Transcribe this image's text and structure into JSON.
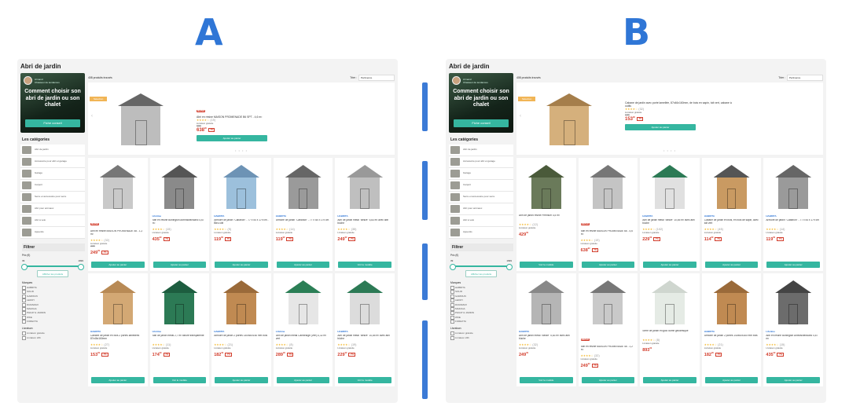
{
  "labels": {
    "a": "A",
    "b": "B"
  },
  "colors": {
    "accent": "#35b6a0",
    "price": "#d23b2a",
    "letter": "#2f76d6"
  },
  "panels": [
    {
      "id": "A",
      "title": "Abri de jardin",
      "result_count": "408 produits trouvés",
      "sort_label": "Trier :",
      "sort_value": "Pertinence",
      "promo": {
        "author": "Armand",
        "role": "Chasseur de tendances",
        "headline": "Comment choisir son abri de jardin ou son chalet",
        "cta": "Fiche conseil"
      },
      "categories_title": "Les catégories",
      "categories": [
        "Abri de jardin",
        "Accessoire pour abri et garage",
        "Garage",
        "Carport",
        "Serre et accessoire pour serre",
        "Abri pour animaux",
        "Abri à vélo",
        "Appentis"
      ],
      "filter_title": "Filtrer",
      "price_label": "Prix (€)",
      "price_min": "39",
      "price_max": "1999",
      "apply_label": "Afficher les produits",
      "brands_title": "Marques",
      "brands": [
        "HABRITA",
        "SOLID",
        "GARDIUN",
        "LEROY",
        "DURAMAX",
        "MAZAGA",
        "PHILIP & JARDIN",
        "WKE",
        "FOREXTA"
      ],
      "delivery_title": "Livraison",
      "delivery": [
        "Livraison gratuite",
        "Livraison 24h"
      ],
      "featured": {
        "tag": "Sélection",
        "badge": "MEPER",
        "title": "Abri en résine MAISON PROMENADE B6 SPT - 4,6 m²",
        "rating": "★★★★☆",
        "reviews": "(19)",
        "shipping": "Livraison gratuite",
        "old_price": "689€",
        "price": "638",
        "cents": "99",
        "discount": "-7%",
        "button": "Ajouter au panier"
      },
      "products": [
        {
          "badge": "MEPER",
          "brand": "",
          "title": "Abri en résine MAISON PROMENADE 48 - 1,2 m²",
          "rating": "★★★★☆",
          "reviews": "(32)",
          "shipping": "Livraison gratuite",
          "price": "249",
          "cents": "99",
          "old": "269€",
          "discount": "-7%",
          "button": "Ajouter au panier",
          "roof": "#777",
          "wall": "#c9c9c9"
        },
        {
          "badge": "",
          "brand": "Lifetime",
          "title": "Abri en résine Burlington Anthracite/Blanc 4,67 m²",
          "rating": "★★★★☆",
          "reviews": "(15)",
          "shipping": "Livraison gratuite",
          "price": "435",
          "cents": "99",
          "old": "",
          "discount": "-7%",
          "button": "Ajouter au panier",
          "roof": "#555",
          "wall": "#8a8a8a"
        },
        {
          "badge": "",
          "brand": "HABRITA",
          "title": "Armoire de jardin \"Cabanon\" - 77 x 54 x 179 cm - Bleu ciel",
          "rating": "★★★★☆",
          "reviews": "(9)",
          "shipping": "Livraison gratuite",
          "price": "119",
          "cents": "99",
          "old": "",
          "discount": "-7%",
          "button": "Ajouter au panier",
          "roof": "#6d93b5",
          "wall": "#9cc0dc"
        },
        {
          "badge": "",
          "brand": "HABRITA",
          "title": "Armoire de jardin \"Cabanon\" - 77 x 54 x 179 cm",
          "rating": "★★★★☆",
          "reviews": "(14)",
          "shipping": "Livraison gratuite",
          "price": "119",
          "cents": "99",
          "old": "",
          "discount": "-7%",
          "button": "Ajouter au panier",
          "roof": "#666",
          "wall": "#9a9a9a"
        },
        {
          "badge": "",
          "brand": "HABRITA",
          "title": "Abri de jardin métal \"Belize\" 5,83 m² avec abri bûche",
          "rating": "★★★★☆",
          "reviews": "(35)",
          "shipping": "Livraison gratuite",
          "price": "249",
          "cents": "99",
          "old": "",
          "discount": "-7%",
          "button": "Voir le modèle",
          "roof": "#999",
          "wall": "#bfbfbf"
        },
        {
          "badge": "",
          "brand": "HABRITA",
          "title": "Cabane de jardin en bois 2 portes lamellées 87x46x160mm",
          "rating": "★★★★☆",
          "reviews": "(27)",
          "shipping": "Livraison gratuite",
          "price": "153",
          "cents": "99",
          "old": "",
          "discount": "-7%",
          "button": "Ajouter au panier",
          "roof": "#b88a55",
          "wall": "#d3a874"
        },
        {
          "badge": "",
          "brand": "Lifetime",
          "title": "Abri de jardin métal 2,7 m² toiture transparente",
          "rating": "★★★★☆",
          "reviews": "(11)",
          "shipping": "Livraison gratuite",
          "price": "174",
          "cents": "99",
          "old": "",
          "discount": "-7%",
          "button": "Voir le modèle",
          "roof": "#1d5d3f",
          "wall": "#2c7a55"
        },
        {
          "badge": "",
          "brand": "HABRITA",
          "title": "Armoire de jardin 2 portes 140x60x160 mm bois",
          "rating": "★★★★☆",
          "reviews": "(21)",
          "shipping": "Livraison gratuite",
          "price": "182",
          "cents": "99",
          "old": "",
          "discount": "-7%",
          "button": "Ajouter au panier",
          "roof": "#9a6a3a",
          "wall": "#c08a52"
        },
        {
          "badge": "",
          "brand": "Lifetime",
          "title": "Abri de jardin métal Cambridge (Vert) 4,32 m² vert",
          "rating": "★★★★☆",
          "reviews": "(8)",
          "shipping": "Livraison gratuite",
          "price": "289",
          "cents": "99",
          "old": "",
          "discount": "-7%",
          "button": "Ajouter au panier",
          "roof": "#2b7f56",
          "wall": "#e6e6e6"
        },
        {
          "badge": "",
          "brand": "HABRITA",
          "title": "Abri de jardin métal \"Belize\" 10,85 m² avec abri bûche",
          "rating": "★★★★☆",
          "reviews": "(19)",
          "shipping": "Livraison gratuite",
          "price": "229",
          "cents": "99",
          "old": "",
          "discount": "-7%",
          "button": "Voir le modèle",
          "roof": "#2c7a55",
          "wall": "#dcdcdc"
        }
      ]
    },
    {
      "id": "B",
      "title": "Abri de jardin",
      "result_count": "408 produits trouvés",
      "sort_label": "Trier :",
      "sort_value": "Pertinence",
      "promo": {
        "author": "Armand",
        "role": "Chasseur de tendances",
        "headline": "Comment choisir son abri de jardin ou son chalet",
        "cta": "Fiche conseil"
      },
      "categories_title": "Les catégories",
      "categories": [
        "Abri de jardin",
        "Accessoire pour abri et garage",
        "Garage",
        "Carport",
        "Serre et accessoire pour serre",
        "Abri pour animaux",
        "Abri à vélo",
        "Appentis"
      ],
      "filter_title": "Filtrer",
      "price_label": "Prix (€)",
      "price_min": "39",
      "price_max": "1999",
      "apply_label": "Afficher les produits",
      "brands_title": "Marques",
      "brands": [
        "HABRITA",
        "SOLID",
        "GARDIUN",
        "LEROY",
        "DURAMAX",
        "MAZAGA",
        "PHILIP & JARDIN",
        "WKE",
        "FOREXTA"
      ],
      "delivery_title": "Livraison",
      "delivery": [
        "Livraison gratuite",
        "Livraison 24h"
      ],
      "featured": {
        "tag": "Sélection",
        "badge": "",
        "title": "Cabane de jardin avec porte lamellée, 87x46x160mm, de bois en sapin, toit vert, cabane à outils",
        "rating": "★★★★☆",
        "reviews": "(32)",
        "shipping": "Livraison gratuite",
        "old_price": "169€",
        "price": "153",
        "cents": "99",
        "discount": "-7%",
        "button": "Ajouter au panier"
      },
      "products": [
        {
          "badge": "",
          "brand": "",
          "title": "Abri de jardin résine Premium 4,5 m²",
          "rating": "★★★★☆",
          "reviews": "(12)",
          "shipping": "Livraison gratuite",
          "price": "429",
          "cents": "99",
          "old": "",
          "discount": "",
          "button": "Voir le modèle",
          "roof": "#4a5a3a",
          "wall": "#6a7a5a"
        },
        {
          "badge": "MEPER",
          "brand": "",
          "title": "Abri en résine MAISON PROMENADE 68 - 4,6 m²",
          "rating": "★★★★☆",
          "reviews": "(19)",
          "shipping": "Livraison gratuite",
          "price": "638",
          "cents": "99",
          "old": "",
          "discount": "-7%",
          "button": "Ajouter au panier",
          "roof": "#777",
          "wall": "#c4c4c4"
        },
        {
          "badge": "",
          "brand": "HABRITA",
          "title": "Abri de jardin métal \"Belize\" 10,85 m² avec abri bûche",
          "rating": "★★★★☆",
          "reviews": "(102)",
          "shipping": "Livraison gratuite",
          "price": "229",
          "cents": "99",
          "old": "",
          "discount": "-7%",
          "button": "Ajouter au panier",
          "roof": "#2c7a55",
          "wall": "#e0e0e0"
        },
        {
          "badge": "",
          "brand": "HABRITA",
          "title": "Cabane de jardin en bois, en bois de sapin, avec toit vert",
          "rating": "★★★★☆",
          "reviews": "(45)",
          "shipping": "Livraison gratuite",
          "price": "114",
          "cents": "99",
          "old": "",
          "discount": "-7%",
          "button": "Ajouter au panier",
          "roof": "#555",
          "wall": "#c99a62"
        },
        {
          "badge": "",
          "brand": "HABRITA",
          "title": "Armoire de jardin \"Cabanon\" - 77 x 54 x 179 cm",
          "rating": "★★★★☆",
          "reviews": "(14)",
          "shipping": "Livraison gratuite",
          "price": "119",
          "cents": "99",
          "old": "",
          "discount": "-7%",
          "button": "Ajouter au panier",
          "roof": "#666",
          "wall": "#9a9a9a"
        },
        {
          "badge": "",
          "brand": "HABRITA",
          "title": "Abri de jardin métal \"Belize\" 5,83 m² avec abri bûche",
          "rating": "★★★★☆",
          "reviews": "(32)",
          "shipping": "Livraison gratuite",
          "price": "249",
          "cents": "99",
          "old": "",
          "discount": "",
          "button": "Voir le modèle",
          "roof": "#888",
          "wall": "#b5b5b5"
        },
        {
          "badge": "MEPER",
          "brand": "",
          "title": "Abri en résine MAISON PROMENADE 48 - 1,2 m²",
          "rating": "★★★★☆",
          "reviews": "(32)",
          "shipping": "Livraison gratuite",
          "price": "249",
          "cents": "99",
          "old": "",
          "discount": "-7%",
          "button": "Ajouter au panier",
          "roof": "#777",
          "wall": "#c9c9c9"
        },
        {
          "badge": "",
          "brand": "",
          "title": "Serre de jardin et igloo dôme géodésique",
          "rating": "★★★★☆",
          "reviews": "(8)",
          "shipping": "Livraison gratuite",
          "price": "893",
          "cents": "99",
          "old": "",
          "discount": "",
          "button": "Ajouter au panier",
          "roof": "#cfd6cf",
          "wall": "#e5ebe5"
        },
        {
          "badge": "",
          "brand": "HABRITA",
          "title": "Armoire de jardin 2 portes 140x60x160 mm bois",
          "rating": "★★★★☆",
          "reviews": "(21)",
          "shipping": "Livraison gratuite",
          "price": "182",
          "cents": "99",
          "old": "",
          "discount": "-7%",
          "button": "Ajouter au panier",
          "roof": "#9a6a3a",
          "wall": "#c08a52"
        },
        {
          "badge": "",
          "brand": "Lifetime",
          "title": "Abri en résine Burlington Anthracite/Blanc 4,67 m²",
          "rating": "★★★★☆",
          "reviews": "(15)",
          "shipping": "Livraison gratuite",
          "price": "435",
          "cents": "99",
          "old": "",
          "discount": "-7%",
          "button": "Ajouter au panier",
          "roof": "#444",
          "wall": "#6c6c6c"
        }
      ]
    }
  ]
}
